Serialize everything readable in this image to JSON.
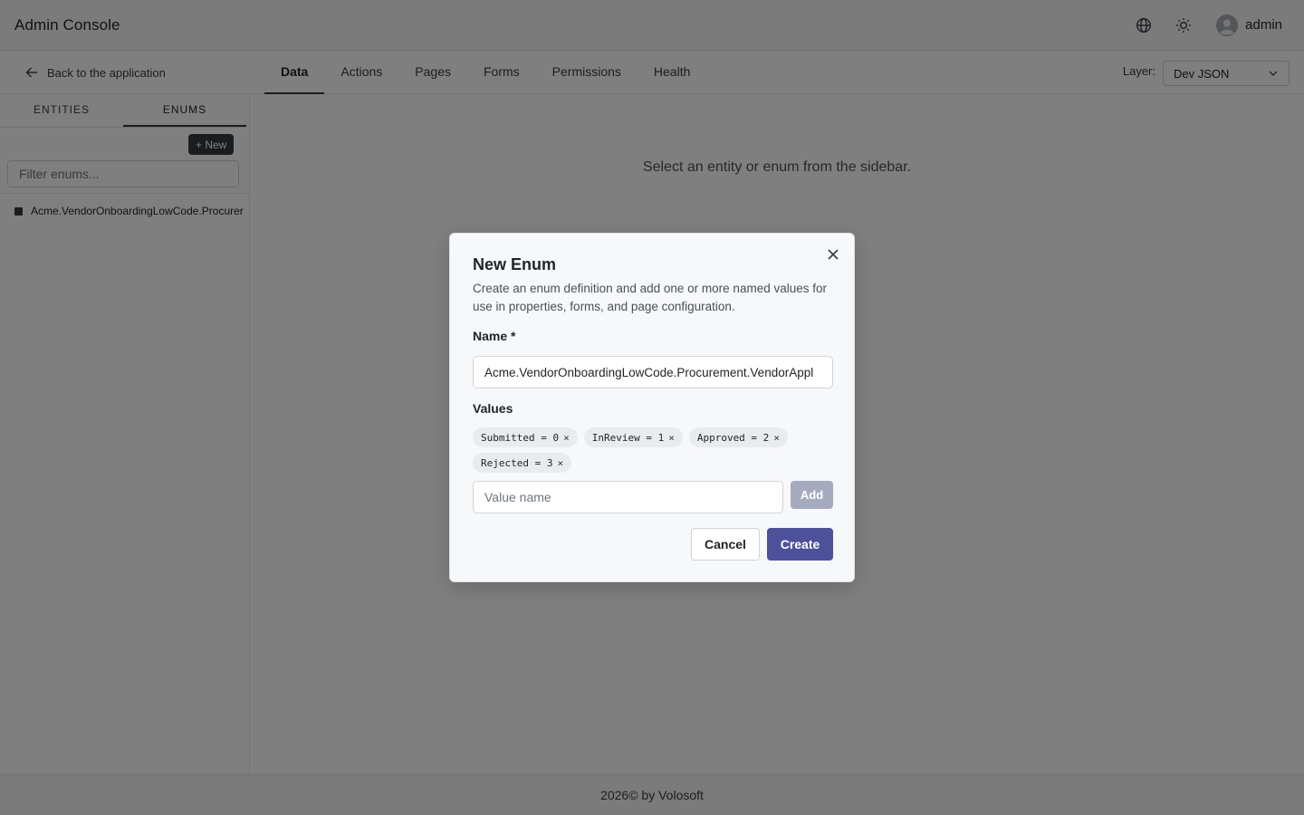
{
  "header": {
    "title": "Admin Console",
    "user_name": "admin",
    "language_icon": "globe-icon",
    "theme_icon": "sun-icon",
    "avatar_icon": "user-avatar-icon"
  },
  "subnav": {
    "back_label": "Back to the application",
    "tabs": [
      {
        "label": "Data",
        "active": true
      },
      {
        "label": "Actions",
        "active": false
      },
      {
        "label": "Pages",
        "active": false
      },
      {
        "label": "Forms",
        "active": false
      },
      {
        "label": "Permissions",
        "active": false
      },
      {
        "label": "Health",
        "active": false
      }
    ],
    "layer_label": "Layer:",
    "layer_value": "Dev JSON"
  },
  "sidebar": {
    "tabs": [
      {
        "label": "ENTITIES",
        "active": false
      },
      {
        "label": "ENUMS",
        "active": true
      }
    ],
    "new_button": "+ New",
    "filter_placeholder": "Filter enums...",
    "items": [
      {
        "label": "Acme.VendorOnboardingLowCode.Procurer"
      }
    ]
  },
  "main": {
    "empty_message": "Select an entity or enum from the sidebar."
  },
  "footer": {
    "text": "2026© by Volosoft"
  },
  "modal": {
    "title": "New Enum",
    "description": "Create an enum definition and add one or more named values for use in properties, forms, and page configuration.",
    "name_label": "Name *",
    "name_value": "Acme.VendorOnboardingLowCode.Procurement.VendorAppl",
    "values_label": "Values",
    "values": [
      {
        "label": "Submitted = 0"
      },
      {
        "label": "InReview = 1"
      },
      {
        "label": "Approved = 2"
      },
      {
        "label": "Rejected = 3"
      }
    ],
    "chip_remove": "×",
    "value_placeholder": "Value name",
    "add_button": "Add",
    "cancel_button": "Cancel",
    "create_button": "Create"
  },
  "colors": {
    "primary": "#4c519a",
    "primary_disabled": "#a5aabf",
    "dark": "#343a40",
    "overlay": "rgba(0,0,0,0.5)"
  }
}
